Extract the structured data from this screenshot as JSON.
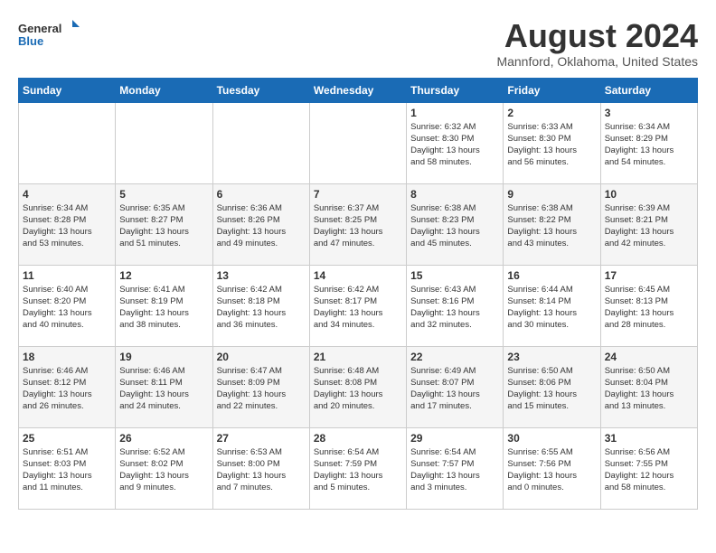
{
  "header": {
    "logo_general": "General",
    "logo_blue": "Blue",
    "month_year": "August 2024",
    "location": "Mannford, Oklahoma, United States"
  },
  "weekdays": [
    "Sunday",
    "Monday",
    "Tuesday",
    "Wednesday",
    "Thursday",
    "Friday",
    "Saturday"
  ],
  "weeks": [
    [
      {
        "day": "",
        "info": ""
      },
      {
        "day": "",
        "info": ""
      },
      {
        "day": "",
        "info": ""
      },
      {
        "day": "",
        "info": ""
      },
      {
        "day": "1",
        "info": "Sunrise: 6:32 AM\nSunset: 8:30 PM\nDaylight: 13 hours\nand 58 minutes."
      },
      {
        "day": "2",
        "info": "Sunrise: 6:33 AM\nSunset: 8:30 PM\nDaylight: 13 hours\nand 56 minutes."
      },
      {
        "day": "3",
        "info": "Sunrise: 6:34 AM\nSunset: 8:29 PM\nDaylight: 13 hours\nand 54 minutes."
      }
    ],
    [
      {
        "day": "4",
        "info": "Sunrise: 6:34 AM\nSunset: 8:28 PM\nDaylight: 13 hours\nand 53 minutes."
      },
      {
        "day": "5",
        "info": "Sunrise: 6:35 AM\nSunset: 8:27 PM\nDaylight: 13 hours\nand 51 minutes."
      },
      {
        "day": "6",
        "info": "Sunrise: 6:36 AM\nSunset: 8:26 PM\nDaylight: 13 hours\nand 49 minutes."
      },
      {
        "day": "7",
        "info": "Sunrise: 6:37 AM\nSunset: 8:25 PM\nDaylight: 13 hours\nand 47 minutes."
      },
      {
        "day": "8",
        "info": "Sunrise: 6:38 AM\nSunset: 8:23 PM\nDaylight: 13 hours\nand 45 minutes."
      },
      {
        "day": "9",
        "info": "Sunrise: 6:38 AM\nSunset: 8:22 PM\nDaylight: 13 hours\nand 43 minutes."
      },
      {
        "day": "10",
        "info": "Sunrise: 6:39 AM\nSunset: 8:21 PM\nDaylight: 13 hours\nand 42 minutes."
      }
    ],
    [
      {
        "day": "11",
        "info": "Sunrise: 6:40 AM\nSunset: 8:20 PM\nDaylight: 13 hours\nand 40 minutes."
      },
      {
        "day": "12",
        "info": "Sunrise: 6:41 AM\nSunset: 8:19 PM\nDaylight: 13 hours\nand 38 minutes."
      },
      {
        "day": "13",
        "info": "Sunrise: 6:42 AM\nSunset: 8:18 PM\nDaylight: 13 hours\nand 36 minutes."
      },
      {
        "day": "14",
        "info": "Sunrise: 6:42 AM\nSunset: 8:17 PM\nDaylight: 13 hours\nand 34 minutes."
      },
      {
        "day": "15",
        "info": "Sunrise: 6:43 AM\nSunset: 8:16 PM\nDaylight: 13 hours\nand 32 minutes."
      },
      {
        "day": "16",
        "info": "Sunrise: 6:44 AM\nSunset: 8:14 PM\nDaylight: 13 hours\nand 30 minutes."
      },
      {
        "day": "17",
        "info": "Sunrise: 6:45 AM\nSunset: 8:13 PM\nDaylight: 13 hours\nand 28 minutes."
      }
    ],
    [
      {
        "day": "18",
        "info": "Sunrise: 6:46 AM\nSunset: 8:12 PM\nDaylight: 13 hours\nand 26 minutes."
      },
      {
        "day": "19",
        "info": "Sunrise: 6:46 AM\nSunset: 8:11 PM\nDaylight: 13 hours\nand 24 minutes."
      },
      {
        "day": "20",
        "info": "Sunrise: 6:47 AM\nSunset: 8:09 PM\nDaylight: 13 hours\nand 22 minutes."
      },
      {
        "day": "21",
        "info": "Sunrise: 6:48 AM\nSunset: 8:08 PM\nDaylight: 13 hours\nand 20 minutes."
      },
      {
        "day": "22",
        "info": "Sunrise: 6:49 AM\nSunset: 8:07 PM\nDaylight: 13 hours\nand 17 minutes."
      },
      {
        "day": "23",
        "info": "Sunrise: 6:50 AM\nSunset: 8:06 PM\nDaylight: 13 hours\nand 15 minutes."
      },
      {
        "day": "24",
        "info": "Sunrise: 6:50 AM\nSunset: 8:04 PM\nDaylight: 13 hours\nand 13 minutes."
      }
    ],
    [
      {
        "day": "25",
        "info": "Sunrise: 6:51 AM\nSunset: 8:03 PM\nDaylight: 13 hours\nand 11 minutes."
      },
      {
        "day": "26",
        "info": "Sunrise: 6:52 AM\nSunset: 8:02 PM\nDaylight: 13 hours\nand 9 minutes."
      },
      {
        "day": "27",
        "info": "Sunrise: 6:53 AM\nSunset: 8:00 PM\nDaylight: 13 hours\nand 7 minutes."
      },
      {
        "day": "28",
        "info": "Sunrise: 6:54 AM\nSunset: 7:59 PM\nDaylight: 13 hours\nand 5 minutes."
      },
      {
        "day": "29",
        "info": "Sunrise: 6:54 AM\nSunset: 7:57 PM\nDaylight: 13 hours\nand 3 minutes."
      },
      {
        "day": "30",
        "info": "Sunrise: 6:55 AM\nSunset: 7:56 PM\nDaylight: 13 hours\nand 0 minutes."
      },
      {
        "day": "31",
        "info": "Sunrise: 6:56 AM\nSunset: 7:55 PM\nDaylight: 12 hours\nand 58 minutes."
      }
    ]
  ]
}
